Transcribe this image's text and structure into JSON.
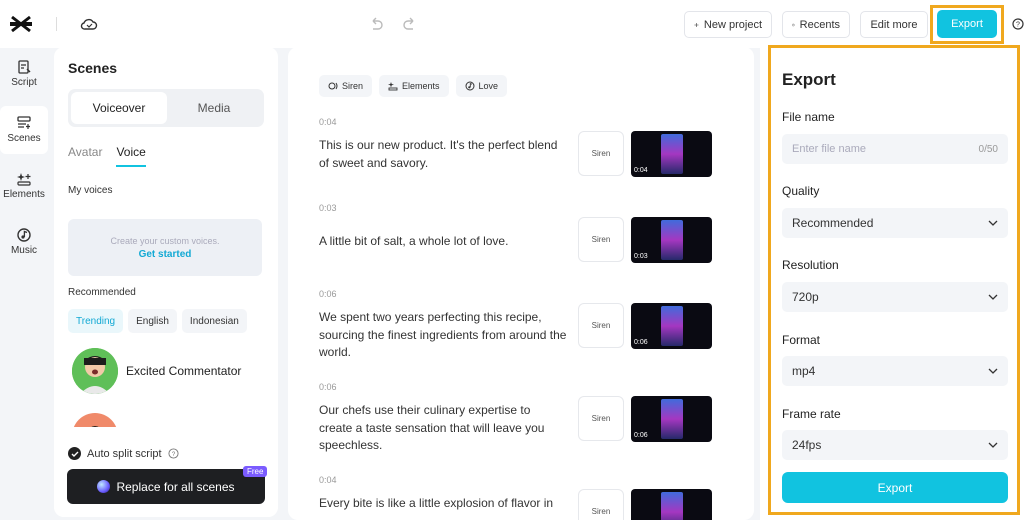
{
  "topbar": {
    "new_project": "New project",
    "recents": "Recents",
    "edit_more": "Edit more",
    "export": "Export"
  },
  "nav": [
    {
      "label": "Script",
      "icon": "script-icon"
    },
    {
      "label": "Scenes",
      "icon": "scenes-icon"
    },
    {
      "label": "Elements",
      "icon": "elements-icon"
    },
    {
      "label": "Music",
      "icon": "music-icon"
    }
  ],
  "scenes_panel": {
    "title": "Scenes",
    "segments": [
      "Voiceover",
      "Media"
    ],
    "sub_tabs": [
      "Avatar",
      "Voice"
    ],
    "my_voices": "My voices",
    "custom_hint": "Create your custom voices.",
    "get_started": "Get started",
    "recommended": "Recommended",
    "chips": [
      "Trending",
      "English",
      "Indonesian"
    ],
    "voice_name": "Excited Commentator",
    "auto_split": "Auto split script",
    "replace_button": "Replace for all scenes",
    "free_badge": "Free"
  },
  "script": {
    "pills": [
      "Siren",
      "Elements",
      "Love"
    ],
    "scenes": [
      {
        "time": "0:04",
        "text": "This is our new product. It's the perfect blend of sweet and savory.",
        "voice": "Siren",
        "thumb_time": "0:04"
      },
      {
        "time": "0:03",
        "text": "A little bit of salt, a whole lot of love.",
        "voice": "Siren",
        "thumb_time": "0:03"
      },
      {
        "time": "0:06",
        "text": "We spent two years perfecting this recipe, sourcing the finest ingredients from around the world.",
        "voice": "Siren",
        "thumb_time": "0:06"
      },
      {
        "time": "0:06",
        "text": "Our chefs use their culinary expertise to create a taste sensation that will leave you speechless.",
        "voice": "Siren",
        "thumb_time": "0:06"
      },
      {
        "time": "0:04",
        "text": "Every bite is like a little explosion of flavor in",
        "voice": "Siren",
        "thumb_time": ""
      }
    ]
  },
  "export_panel": {
    "title": "Export",
    "file_name_label": "File name",
    "file_name_placeholder": "Enter file name",
    "file_name_count": "0/50",
    "quality_label": "Quality",
    "quality_value": "Recommended",
    "resolution_label": "Resolution",
    "resolution_value": "720p",
    "format_label": "Format",
    "format_value": "mp4",
    "frame_rate_label": "Frame rate",
    "frame_rate_value": "24fps",
    "export_button": "Export"
  },
  "colors": {
    "accent": "#11c3e0",
    "highlight": "#f0a81e"
  }
}
